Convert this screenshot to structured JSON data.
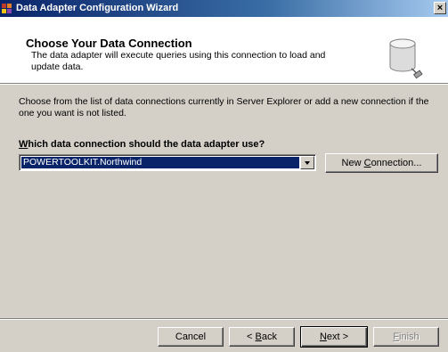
{
  "window": {
    "title": "Data Adapter Configuration Wizard",
    "close_glyph": "×",
    "icon": "wizard-app-icon"
  },
  "header": {
    "title": "Choose Your Data Connection",
    "description": "The data adapter will execute queries using this connection to load and update data.",
    "icon": "database-connection-icon"
  },
  "body": {
    "instructions": "Choose from the list of data connections currently in Server Explorer or add a new connection if the one you want is not listed.",
    "question_accel": "W",
    "question_rest": "hich data connection should the data adapter use?"
  },
  "connection_select": {
    "selected": "POWERTOOLKIT.Northwind"
  },
  "buttons": {
    "new_connection_pre": "New ",
    "new_connection_accel": "C",
    "new_connection_post": "onnection...",
    "cancel": "Cancel",
    "back_pre": "< ",
    "back_accel": "B",
    "back_post": "ack",
    "next_accel": "N",
    "next_post": "ext >",
    "finish_accel": "F",
    "finish_post": "inish"
  },
  "colors": {
    "title_bar": "#0a246a",
    "dialog_face": "#d4d0c8",
    "selection": "#0a246a"
  }
}
